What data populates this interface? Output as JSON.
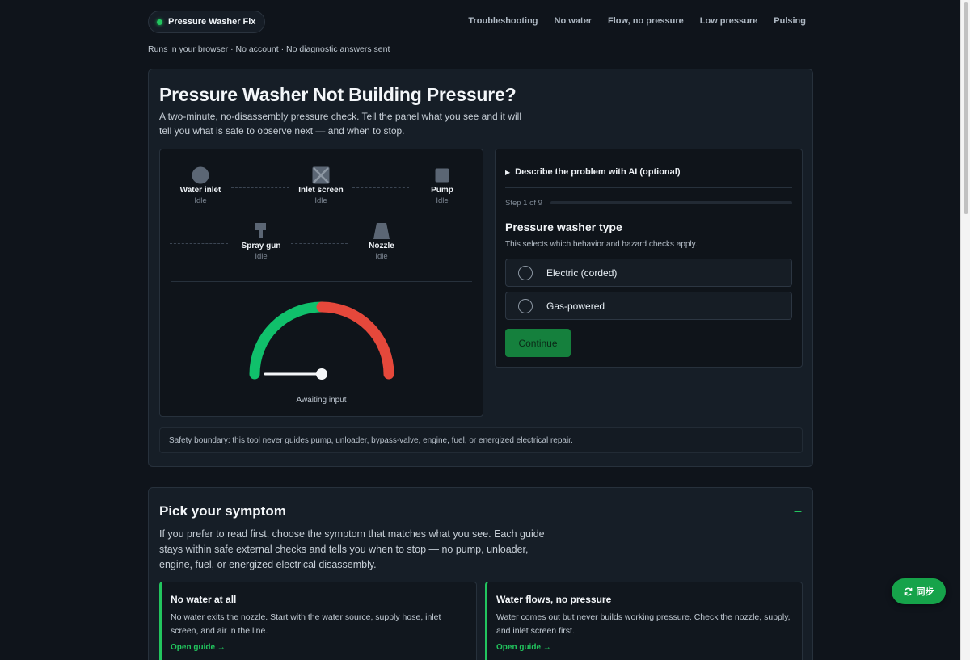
{
  "header": {
    "brand": "Pressure Washer Fix",
    "nav": [
      "Troubleshooting",
      "No water",
      "Flow, no pressure",
      "Low pressure",
      "Pulsing"
    ],
    "tagline": "Runs in your browser · No account · No diagnostic answers sent"
  },
  "hero": {
    "title": "Pressure Washer Not Building Pressure?",
    "intro": "A two-minute, no-disassembly pressure check. Tell the panel what you see and it will tell you what is safe to observe next — and when to stop."
  },
  "diagram": {
    "nodes": [
      {
        "name": "Water inlet",
        "status": "Idle"
      },
      {
        "name": "Inlet screen",
        "status": "Idle"
      },
      {
        "name": "Pump",
        "status": "Idle"
      },
      {
        "name": "Spray gun",
        "status": "Idle"
      },
      {
        "name": "Nozzle",
        "status": "Idle"
      }
    ],
    "gauge_label": "Awaiting input",
    "gauge_level": 0
  },
  "wizard": {
    "ai_toggle": "Describe the problem with AI (optional)",
    "step": "Step 1 of 9",
    "progress": 0,
    "question": "Pressure washer type",
    "subtitle": "This selects which behavior and hazard checks apply.",
    "options": [
      "Electric (corded)",
      "Gas-powered"
    ],
    "continue": "Continue"
  },
  "safety": "Safety boundary: this tool never guides pump, unloader, bypass-valve, engine, fuel, or energized electrical repair.",
  "symptoms": {
    "title": "Pick your symptom",
    "toggle": "–",
    "desc": "If you prefer to read first, choose the symptom that matches what you see. Each guide stays within safe external checks and tells you when to stop — no pump, unloader, engine, fuel, or energized electrical disassembly.",
    "cards": [
      {
        "title": "No water at all",
        "desc": "No water exits the nozzle. Start with the water source, supply hose, inlet screen, and air in the line.",
        "link": "Open guide →"
      },
      {
        "title": "Water flows, no pressure",
        "desc": "Water comes out but never builds working pressure. Check the nozzle, supply, and inlet screen first.",
        "link": "Open guide →"
      }
    ]
  },
  "sync": {
    "label": "同步"
  },
  "colors": {
    "accent": "#22c55e",
    "danger": "#e5483b",
    "bg": "#0f141b"
  }
}
